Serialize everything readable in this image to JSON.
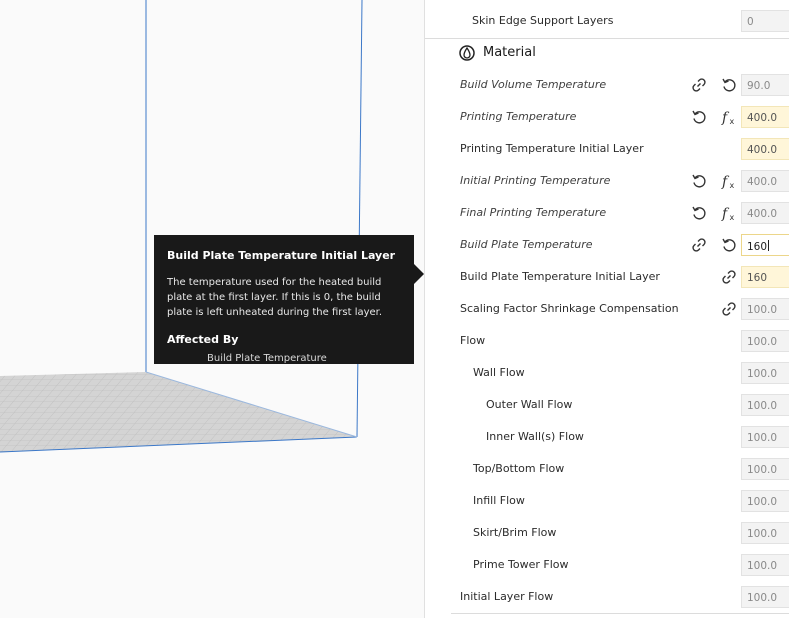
{
  "tooltip": {
    "title": "Build Plate Temperature Initial Layer",
    "body": "The temperature used for the heated build plate at the first layer. If this is 0, the build plate is left unheated during the first layer.",
    "affected_by_label": "Affected By",
    "affected_item": "Build Plate Temperature"
  },
  "settings": {
    "top_row": {
      "label": "Skin Edge Support Layers",
      "value": "0"
    },
    "section": {
      "title": "Material",
      "icon": "material-icon"
    },
    "rows": [
      {
        "label": "Build Volume Temperature",
        "value": "90.0",
        "italic": true,
        "indent": 0,
        "icons": [
          "link-icon",
          "reset-icon"
        ],
        "state": "normal"
      },
      {
        "label": "Printing Temperature",
        "value": "400.0",
        "italic": true,
        "indent": 0,
        "icons": [
          "reset-icon",
          "function-icon"
        ],
        "state": "warn"
      },
      {
        "label": "Printing Temperature Initial Layer",
        "value": "400.0",
        "italic": false,
        "indent": 0,
        "icons": [],
        "state": "warn"
      },
      {
        "label": "Initial Printing Temperature",
        "value": "400.0",
        "italic": true,
        "indent": 0,
        "icons": [
          "reset-icon",
          "function-icon"
        ],
        "state": "normal"
      },
      {
        "label": "Final Printing Temperature",
        "value": "400.0",
        "italic": true,
        "indent": 0,
        "icons": [
          "reset-icon",
          "function-icon"
        ],
        "state": "normal"
      },
      {
        "label": "Build Plate Temperature",
        "value": "160",
        "italic": true,
        "indent": 0,
        "icons": [
          "link-icon",
          "reset-icon"
        ],
        "state": "active"
      },
      {
        "label": "Build Plate Temperature Initial Layer",
        "value": "160",
        "italic": false,
        "indent": 0,
        "icons": [
          "link-icon"
        ],
        "state": "warn"
      },
      {
        "label": "Scaling Factor Shrinkage Compensation",
        "value": "100.0",
        "italic": false,
        "indent": 0,
        "icons": [
          "link-icon"
        ],
        "state": "normal"
      },
      {
        "label": "Flow",
        "value": "100.0",
        "italic": false,
        "indent": 0,
        "icons": [],
        "state": "normal"
      },
      {
        "label": "Wall Flow",
        "value": "100.0",
        "italic": false,
        "indent": 1,
        "icons": [],
        "state": "normal"
      },
      {
        "label": "Outer Wall Flow",
        "value": "100.0",
        "italic": false,
        "indent": 2,
        "icons": [],
        "state": "normal"
      },
      {
        "label": "Inner Wall(s) Flow",
        "value": "100.0",
        "italic": false,
        "indent": 2,
        "icons": [],
        "state": "normal"
      },
      {
        "label": "Top/Bottom Flow",
        "value": "100.0",
        "italic": false,
        "indent": 1,
        "icons": [],
        "state": "normal"
      },
      {
        "label": "Infill Flow",
        "value": "100.0",
        "italic": false,
        "indent": 1,
        "icons": [],
        "state": "normal"
      },
      {
        "label": "Skirt/Brim Flow",
        "value": "100.0",
        "italic": false,
        "indent": 1,
        "icons": [],
        "state": "normal"
      },
      {
        "label": "Prime Tower Flow",
        "value": "100.0",
        "italic": false,
        "indent": 1,
        "icons": [],
        "state": "normal"
      },
      {
        "label": "Initial Layer Flow",
        "value": "100.0",
        "italic": false,
        "indent": 0,
        "icons": [],
        "state": "normal"
      }
    ]
  },
  "colors": {
    "tooltip_bg": "#191919",
    "accent_blue": "#3c78c8",
    "warn_bg": "#fff6d9"
  }
}
